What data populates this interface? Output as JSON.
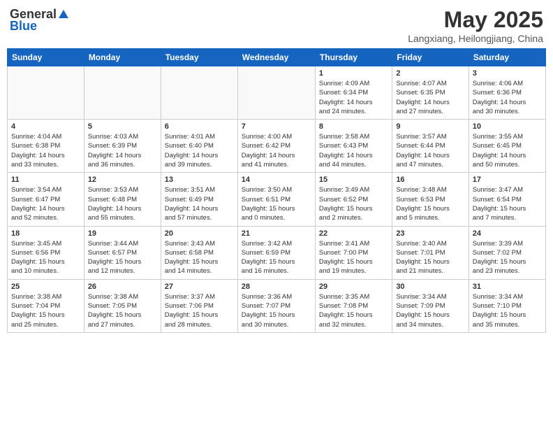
{
  "logo": {
    "general": "General",
    "blue": "Blue"
  },
  "title": "May 2025",
  "location": "Langxiang, Heilongjiang, China",
  "days_of_week": [
    "Sunday",
    "Monday",
    "Tuesday",
    "Wednesday",
    "Thursday",
    "Friday",
    "Saturday"
  ],
  "weeks": [
    [
      {
        "num": "",
        "info": ""
      },
      {
        "num": "",
        "info": ""
      },
      {
        "num": "",
        "info": ""
      },
      {
        "num": "",
        "info": ""
      },
      {
        "num": "1",
        "info": "Sunrise: 4:09 AM\nSunset: 6:34 PM\nDaylight: 14 hours\nand 24 minutes."
      },
      {
        "num": "2",
        "info": "Sunrise: 4:07 AM\nSunset: 6:35 PM\nDaylight: 14 hours\nand 27 minutes."
      },
      {
        "num": "3",
        "info": "Sunrise: 4:06 AM\nSunset: 6:36 PM\nDaylight: 14 hours\nand 30 minutes."
      }
    ],
    [
      {
        "num": "4",
        "info": "Sunrise: 4:04 AM\nSunset: 6:38 PM\nDaylight: 14 hours\nand 33 minutes."
      },
      {
        "num": "5",
        "info": "Sunrise: 4:03 AM\nSunset: 6:39 PM\nDaylight: 14 hours\nand 36 minutes."
      },
      {
        "num": "6",
        "info": "Sunrise: 4:01 AM\nSunset: 6:40 PM\nDaylight: 14 hours\nand 39 minutes."
      },
      {
        "num": "7",
        "info": "Sunrise: 4:00 AM\nSunset: 6:42 PM\nDaylight: 14 hours\nand 41 minutes."
      },
      {
        "num": "8",
        "info": "Sunrise: 3:58 AM\nSunset: 6:43 PM\nDaylight: 14 hours\nand 44 minutes."
      },
      {
        "num": "9",
        "info": "Sunrise: 3:57 AM\nSunset: 6:44 PM\nDaylight: 14 hours\nand 47 minutes."
      },
      {
        "num": "10",
        "info": "Sunrise: 3:55 AM\nSunset: 6:45 PM\nDaylight: 14 hours\nand 50 minutes."
      }
    ],
    [
      {
        "num": "11",
        "info": "Sunrise: 3:54 AM\nSunset: 6:47 PM\nDaylight: 14 hours\nand 52 minutes."
      },
      {
        "num": "12",
        "info": "Sunrise: 3:53 AM\nSunset: 6:48 PM\nDaylight: 14 hours\nand 55 minutes."
      },
      {
        "num": "13",
        "info": "Sunrise: 3:51 AM\nSunset: 6:49 PM\nDaylight: 14 hours\nand 57 minutes."
      },
      {
        "num": "14",
        "info": "Sunrise: 3:50 AM\nSunset: 6:51 PM\nDaylight: 15 hours\nand 0 minutes."
      },
      {
        "num": "15",
        "info": "Sunrise: 3:49 AM\nSunset: 6:52 PM\nDaylight: 15 hours\nand 2 minutes."
      },
      {
        "num": "16",
        "info": "Sunrise: 3:48 AM\nSunset: 6:53 PM\nDaylight: 15 hours\nand 5 minutes."
      },
      {
        "num": "17",
        "info": "Sunrise: 3:47 AM\nSunset: 6:54 PM\nDaylight: 15 hours\nand 7 minutes."
      }
    ],
    [
      {
        "num": "18",
        "info": "Sunrise: 3:45 AM\nSunset: 6:56 PM\nDaylight: 15 hours\nand 10 minutes."
      },
      {
        "num": "19",
        "info": "Sunrise: 3:44 AM\nSunset: 6:57 PM\nDaylight: 15 hours\nand 12 minutes."
      },
      {
        "num": "20",
        "info": "Sunrise: 3:43 AM\nSunset: 6:58 PM\nDaylight: 15 hours\nand 14 minutes."
      },
      {
        "num": "21",
        "info": "Sunrise: 3:42 AM\nSunset: 6:59 PM\nDaylight: 15 hours\nand 16 minutes."
      },
      {
        "num": "22",
        "info": "Sunrise: 3:41 AM\nSunset: 7:00 PM\nDaylight: 15 hours\nand 19 minutes."
      },
      {
        "num": "23",
        "info": "Sunrise: 3:40 AM\nSunset: 7:01 PM\nDaylight: 15 hours\nand 21 minutes."
      },
      {
        "num": "24",
        "info": "Sunrise: 3:39 AM\nSunset: 7:02 PM\nDaylight: 15 hours\nand 23 minutes."
      }
    ],
    [
      {
        "num": "25",
        "info": "Sunrise: 3:38 AM\nSunset: 7:04 PM\nDaylight: 15 hours\nand 25 minutes."
      },
      {
        "num": "26",
        "info": "Sunrise: 3:38 AM\nSunset: 7:05 PM\nDaylight: 15 hours\nand 27 minutes."
      },
      {
        "num": "27",
        "info": "Sunrise: 3:37 AM\nSunset: 7:06 PM\nDaylight: 15 hours\nand 28 minutes."
      },
      {
        "num": "28",
        "info": "Sunrise: 3:36 AM\nSunset: 7:07 PM\nDaylight: 15 hours\nand 30 minutes."
      },
      {
        "num": "29",
        "info": "Sunrise: 3:35 AM\nSunset: 7:08 PM\nDaylight: 15 hours\nand 32 minutes."
      },
      {
        "num": "30",
        "info": "Sunrise: 3:34 AM\nSunset: 7:09 PM\nDaylight: 15 hours\nand 34 minutes."
      },
      {
        "num": "31",
        "info": "Sunrise: 3:34 AM\nSunset: 7:10 PM\nDaylight: 15 hours\nand 35 minutes."
      }
    ]
  ]
}
